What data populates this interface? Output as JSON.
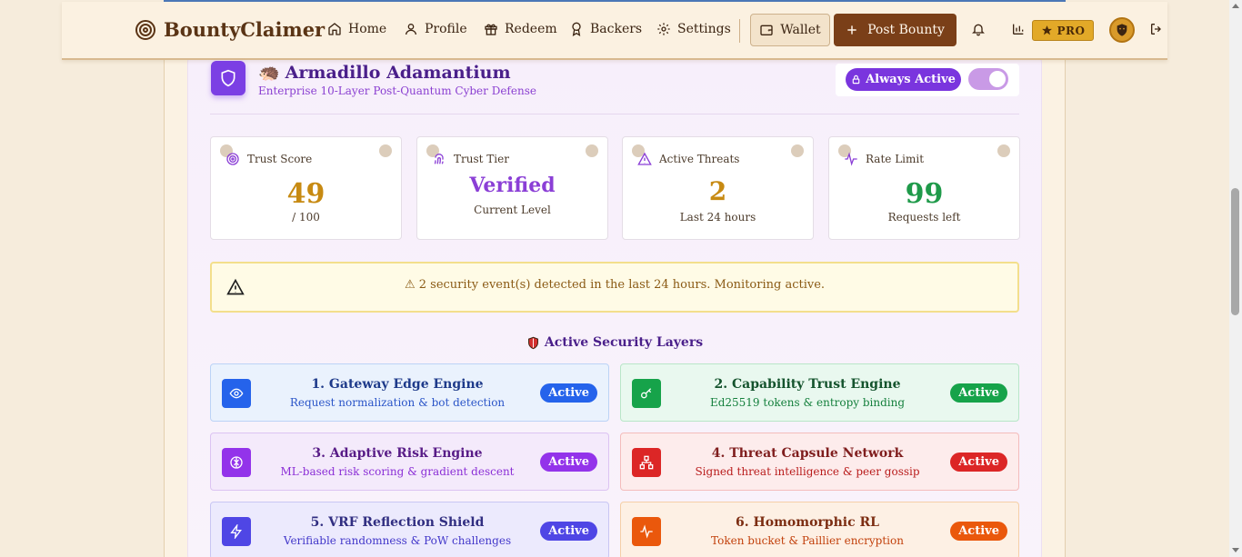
{
  "brand": {
    "name": "BountyClaimer"
  },
  "nav": {
    "items": [
      {
        "label": "Home",
        "icon": "home-icon"
      },
      {
        "label": "Profile",
        "icon": "user-icon"
      },
      {
        "label": "Redeem",
        "icon": "gift-icon"
      },
      {
        "label": "Backers",
        "icon": "award-icon"
      },
      {
        "label": "Settings",
        "icon": "gear-icon"
      }
    ],
    "wallet_label": "Wallet",
    "post_label": "Post Bounty",
    "pro_label": "PRO"
  },
  "header": {
    "emoji": "🦔",
    "title": "Armadillo Adamantium",
    "subtitle": "Enterprise 10-Layer Post-Quantum Cyber Defense",
    "always_label": "Always Active",
    "toggle_on": true
  },
  "stats": [
    {
      "label": "Trust Score",
      "value": "49",
      "sub": "/ 100",
      "color": "#c78a12"
    },
    {
      "label": "Trust Tier",
      "value": "Verified",
      "sub": "Current Level",
      "color": "#8b3fd6"
    },
    {
      "label": "Active Threats",
      "value": "2",
      "sub": "Last 24 hours",
      "color": "#c78a12"
    },
    {
      "label": "Rate Limit",
      "value": "99",
      "sub": "Requests left",
      "color": "#1f9a4a"
    }
  ],
  "alert": {
    "text": "⚠ 2 security event(s) detected in the last 24 hours. Monitoring active."
  },
  "layers_section": {
    "title": "Active Security Layers"
  },
  "layers": [
    {
      "title": "1. Gateway Edge Engine",
      "desc": "Request normalization & bot detection",
      "badge": "Active",
      "accent": "#2563eb"
    },
    {
      "title": "2. Capability Trust Engine",
      "desc": "Ed25519 tokens & entropy binding",
      "badge": "Active",
      "accent": "#16a34a"
    },
    {
      "title": "3. Adaptive Risk Engine",
      "desc": "ML-based risk scoring & gradient descent",
      "badge": "Active",
      "accent": "#9333ea"
    },
    {
      "title": "4. Threat Capsule Network",
      "desc": "Signed threat intelligence & peer gossip",
      "badge": "Active",
      "accent": "#dc2626"
    },
    {
      "title": "5. VRF Reflection Shield",
      "desc": "Verifiable randomness & PoW challenges",
      "badge": "Active",
      "accent": "#4f46e5"
    },
    {
      "title": "6. Homomorphic RL",
      "desc": "Token bucket & Paillier encryption",
      "badge": "Active",
      "accent": "#ea580c"
    }
  ]
}
